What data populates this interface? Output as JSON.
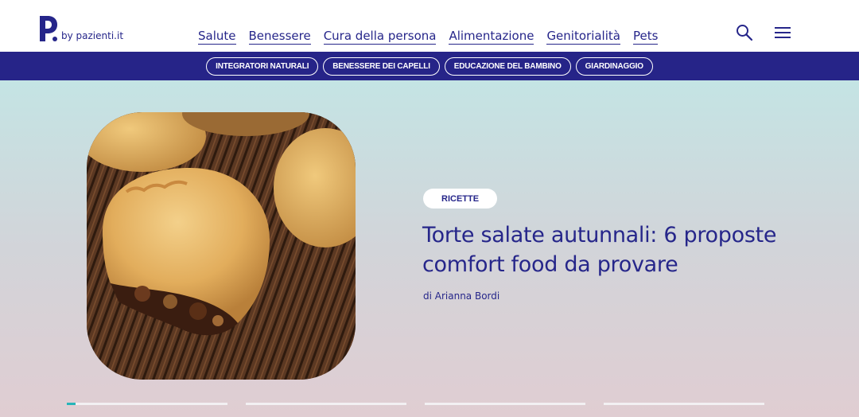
{
  "header": {
    "logo_text": "by pazienti.it",
    "nav": [
      "Salute",
      "Benessere",
      "Cura della persona",
      "Alimentazione",
      "Genitorialità",
      "Pets"
    ],
    "icons": {
      "search": "search-icon",
      "menu": "hamburger-menu-icon"
    }
  },
  "subnav": {
    "pills": [
      "INTEGRATORI NATURALI",
      "BENESSERE DEI CAPELLI",
      "EDUCAZIONE DEL BAMBINO",
      "GIARDINAGGIO"
    ]
  },
  "hero": {
    "tag": "RICETTE",
    "title": "Torte salate autunnali: 6 proposte comfort food da provare",
    "author": "di Arianna Bordi",
    "image": "savory-mini-pies-photo",
    "slides": 4,
    "active_slide": 1
  },
  "colors": {
    "brand": "#26268a",
    "subnav_bg": "#262488",
    "indicator_active": "#27b5b9"
  }
}
